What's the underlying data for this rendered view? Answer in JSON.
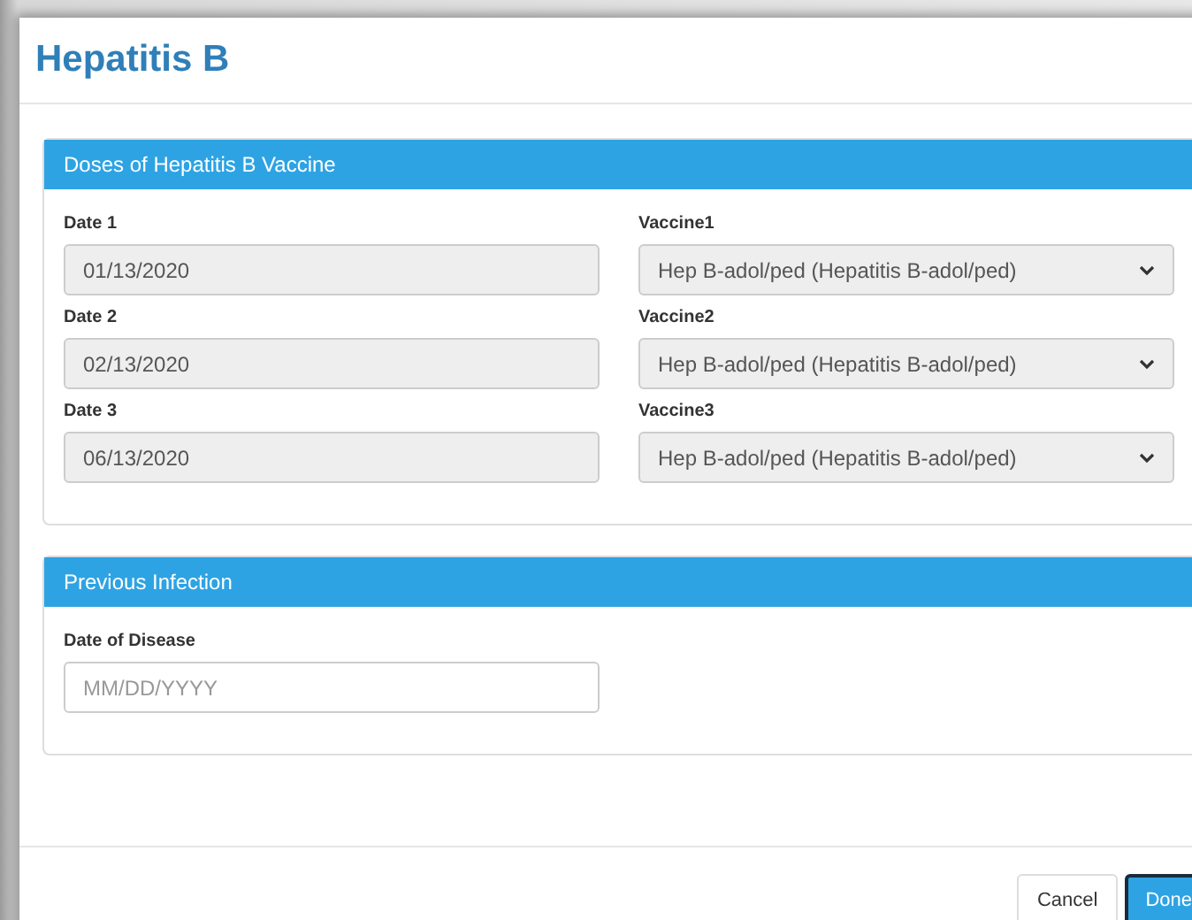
{
  "title": "Hepatitis B",
  "panels": [
    {
      "heading": "Doses of Hepatitis B Vaccine",
      "rows": [
        {
          "date_label": "Date 1",
          "date_value": "01/13/2020",
          "vaccine_label": "Vaccine1",
          "vaccine_value": "Hep B-adol/ped (Hepatitis B-adol/ped)"
        },
        {
          "date_label": "Date 2",
          "date_value": "02/13/2020",
          "vaccine_label": "Vaccine2",
          "vaccine_value": "Hep B-adol/ped (Hepatitis B-adol/ped)"
        },
        {
          "date_label": "Date 3",
          "date_value": "06/13/2020",
          "vaccine_label": "Vaccine3",
          "vaccine_value": "Hep B-adol/ped (Hepatitis B-adol/ped)"
        }
      ]
    },
    {
      "heading": "Previous Infection",
      "fields": [
        {
          "label": "Date of Disease",
          "placeholder": "MM/DD/YYYY"
        }
      ]
    }
  ],
  "buttons": [
    {
      "label": "Cancel",
      "kind": "default"
    },
    {
      "label": "Done",
      "kind": "primary"
    }
  ]
}
